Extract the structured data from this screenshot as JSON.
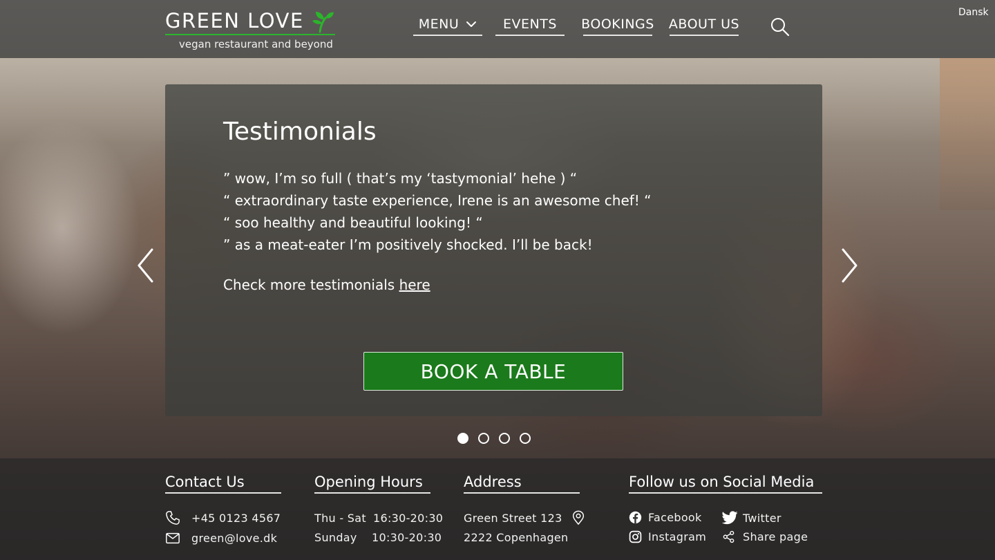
{
  "header": {
    "logo_title": "GREEN LOVE",
    "logo_tagline": "vegan restaurant and beyond",
    "nav": {
      "menu": "MENU",
      "events": "EVENTS",
      "bookings": "BOOKINGS",
      "about": "ABOUT US"
    },
    "language": "Dansk",
    "brand_color": "#2bb52b"
  },
  "carousel": {
    "title": "Testimonials",
    "quotes": [
      "” wow, I’m so full  ( that’s my ‘tastymonial’ hehe ) “",
      "“ extraordinary taste experience, Irene is an awesome chef! “",
      "“ soo healthy and beautiful looking! “",
      "” as a meat-eater I’m positively shocked.  I’ll be back!"
    ],
    "more_prefix": "Check more testimonials ",
    "more_link": "here",
    "cta": "BOOK A TABLE",
    "cta_color": "#1b7a1b",
    "slides": 4,
    "active_slide": 1
  },
  "footer": {
    "contact": {
      "heading": "Contact  Us",
      "phone": "+45 0123 4567",
      "email": "green@love.dk"
    },
    "hours": {
      "heading": "Opening Hours",
      "rows": [
        {
          "day": "Thu - Sat",
          "time": "16:30-20:30"
        },
        {
          "day": "Sunday",
          "time": "10:30-20:30"
        }
      ]
    },
    "address": {
      "heading": "Address",
      "street": "Green Street 123",
      "city": "2222 Copenhagen"
    },
    "social": {
      "heading": "Follow us on Social Media",
      "facebook": "Facebook",
      "twitter": "Twitter",
      "instagram": "Instagram",
      "share": "Share page"
    }
  }
}
